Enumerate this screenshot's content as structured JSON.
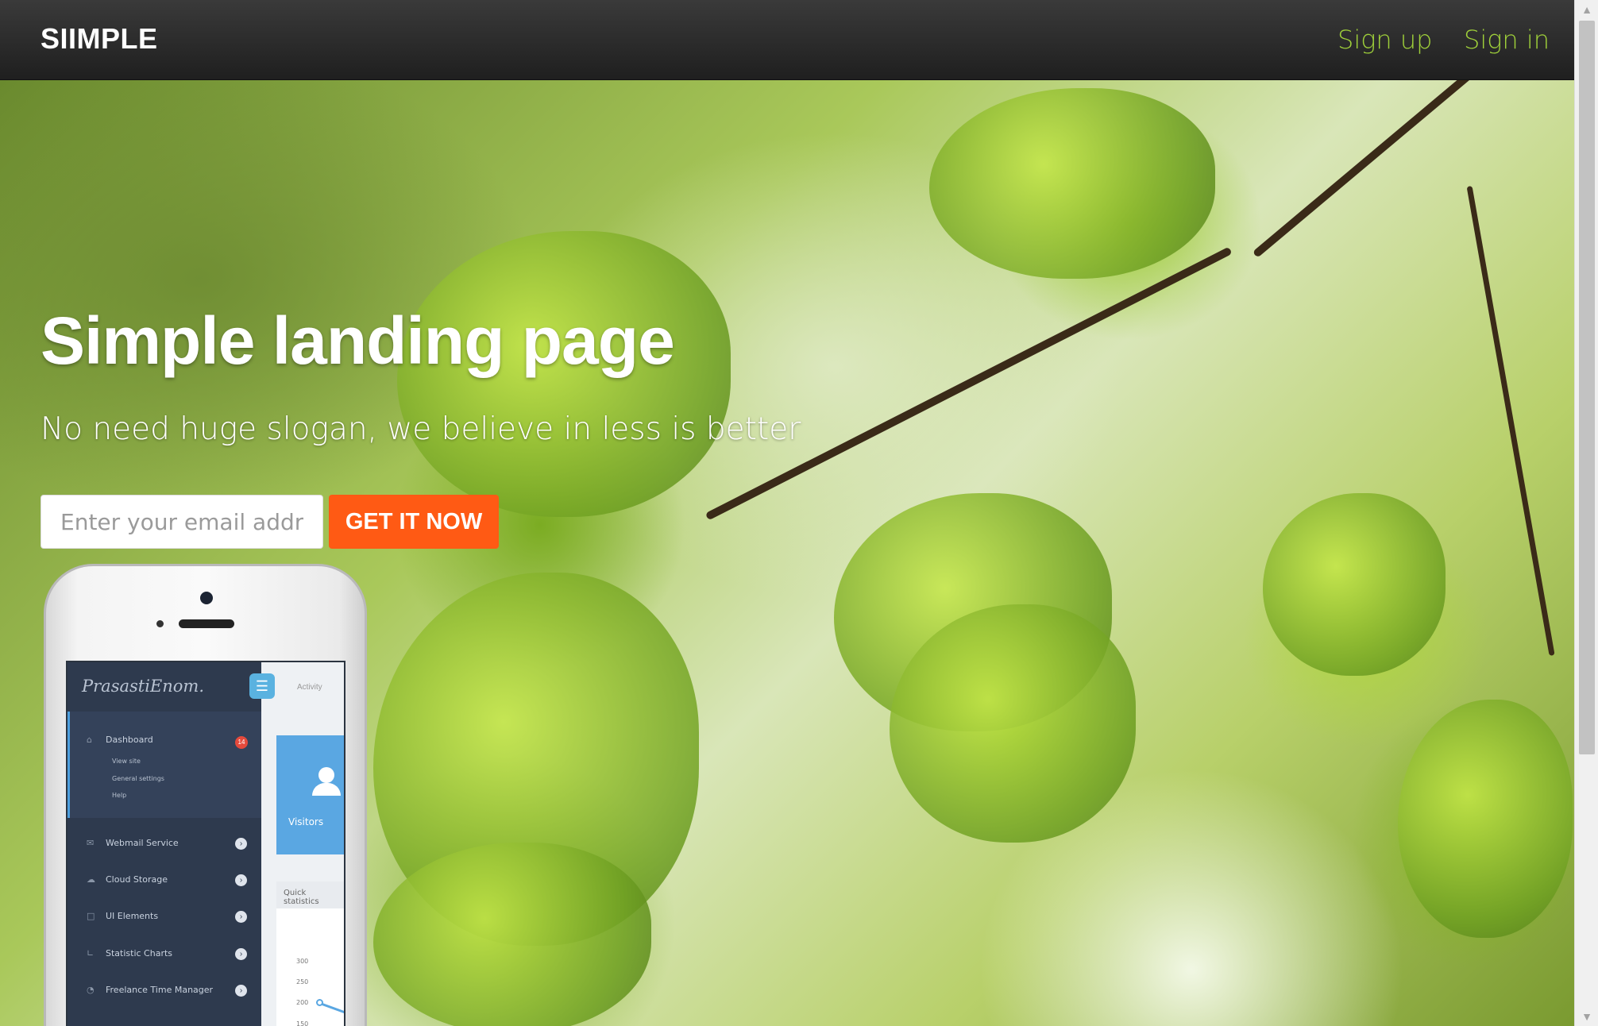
{
  "navbar": {
    "brand": "SIIMPLE",
    "links": [
      {
        "label": "Sign up"
      },
      {
        "label": "Sign in"
      }
    ]
  },
  "hero": {
    "title": "Simple landing page",
    "subtitle": "No need huge slogan, we believe in less is better",
    "email_placeholder": "Enter your email address",
    "cta_label": "GET IT NOW"
  },
  "phone_app": {
    "logo": "PrasastiEnom.",
    "tab": "Activity",
    "menu": [
      {
        "label": "Dashboard",
        "icon": "home-icon",
        "badge": "14"
      },
      {
        "label": "Webmail Service",
        "icon": "mail-icon"
      },
      {
        "label": "Cloud Storage",
        "icon": "cloud-icon"
      },
      {
        "label": "UI Elements",
        "icon": "window-icon"
      },
      {
        "label": "Statistic Charts",
        "icon": "chart-icon"
      },
      {
        "label": "Freelance Time Manager",
        "icon": "clock-icon"
      }
    ],
    "submenu": [
      "View site",
      "General settings",
      "Help"
    ],
    "visitors_label": "Visitors",
    "quick_stats_label": "Quick statistics",
    "axis_ticks": [
      "300",
      "250",
      "200",
      "150"
    ]
  },
  "colors": {
    "accent_green": "#9fd03a",
    "cta_orange": "#ff5a14",
    "navbar_bg": "#2b2b2b"
  }
}
